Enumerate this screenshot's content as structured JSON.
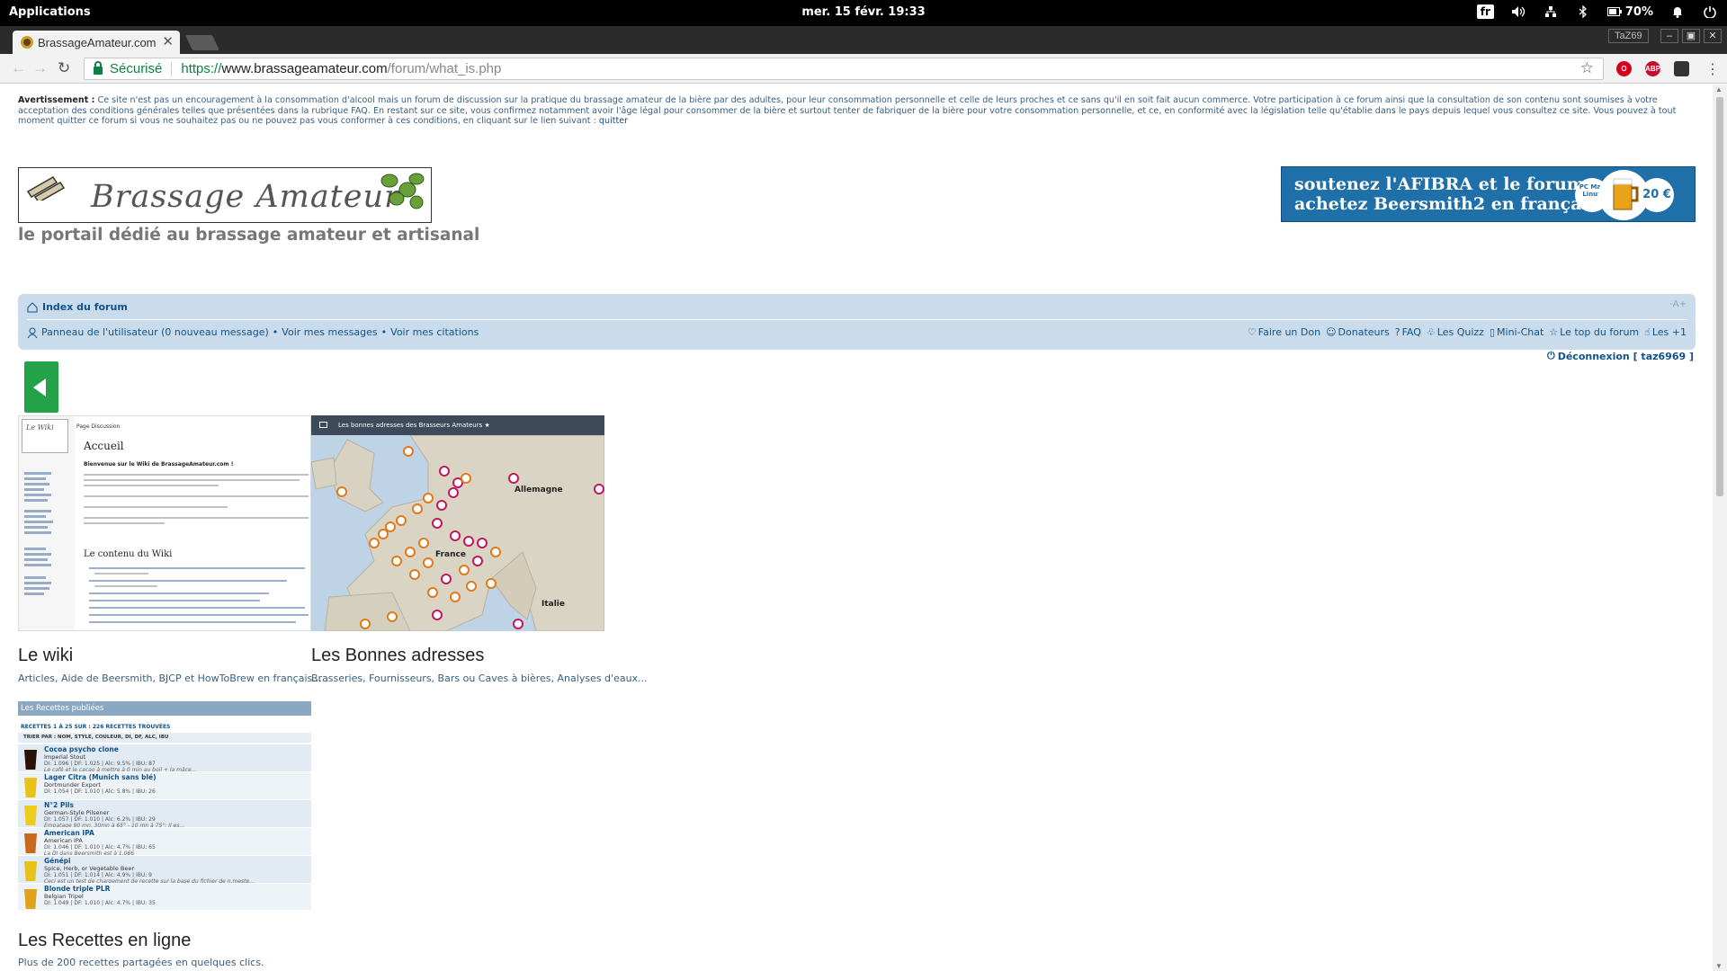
{
  "os": {
    "apps_label": "Applications",
    "clock": "mer. 15 févr.   19:33",
    "keyboard": "fr",
    "battery": "70%"
  },
  "browser": {
    "tab_title": "BrassageAmateur.com",
    "profile": "TaZ69",
    "secure_label": "Sécurisé",
    "url_scheme": "https://",
    "url_host": "www.brassageamateur.com",
    "url_path": "/forum/what_is.php",
    "ext_abp": "ABP"
  },
  "warning": {
    "label": "Avertissement :",
    "text": " Ce site n'est pas un encouragement à la consommation d'alcool mais un forum de discussion sur la pratique du brassage amateur de la bière par des adultes, pour leur consommation personnelle et celle de leurs proches et ce sans qu'il en soit fait aucun commerce. Votre participation à ce forum ainsi que la consultation de son contenu sont soumises à votre acceptation des conditions générales telles que présentées dans la rubrique FAQ. En restant sur ce site, vous confirmez notamment avoir l'âge légal pour consommer de la bière et surtout tenter de fabriquer de la bière pour votre consommation personnelle, et ce, en conformité avec la législation telle qu'établie dans le pays depuis lequel vous consultez ce site. Vous pouvez à tout moment quitter ce forum si vous ne souhaitez pas ou ne pouvez pas vous conformer à ces conditions, en cliquant sur le lien suivant : ",
    "link": "quitter"
  },
  "header": {
    "logo_text": "Brassage Amateur",
    "tagline": "le portail dédié au brassage amateur et artisanal",
    "banner_line1": "soutenez l'AFIBRA et le forum",
    "banner_line2": "achetez Beersmith2 en français",
    "banner_badge": "PC Mac Linux",
    "banner_price": "20 €"
  },
  "nav": {
    "index": "Index du forum",
    "font_size": "-A+",
    "user_panel": "Panneau de l'utilisateur (0 nouveau message)",
    "my_messages": "Voir mes messages",
    "my_quotes": "Voir mes citations",
    "links": [
      "Faire un Don",
      "Donateurs",
      "FAQ",
      "Les Quizz",
      "Mini-Chat",
      "Le top du forum",
      "Les +1"
    ],
    "logout": "Déconnexion [ taz6969 ]"
  },
  "cards": {
    "wiki": {
      "title": "Le wiki",
      "desc": "Articles, Aide de Beersmith, BJCP et HowToBrew en français...",
      "h1": "Accueil",
      "h2": "Le contenu du Wiki",
      "bold": "Bienvenue sur le Wiki de BrassageAmateur.com !",
      "tabs": "Page   Discussion",
      "logo": "Le Wiki"
    },
    "map": {
      "title": "Les Bonnes adresses",
      "desc": "Brasseries, Fournisseurs, Bars ou Caves à bières, Analyses d'eaux...",
      "header": "Les bonnes adresses des Brasseurs Amateurs ★",
      "labels": [
        "Allemagne",
        "France",
        "Italie"
      ]
    },
    "recipes": {
      "title": "Les Recettes en ligne",
      "desc": "Plus de 200 recettes partagées en quelques clics.",
      "header": "Les Recettes publiées",
      "count": "RECETTES 1 À 25 SUR : 226 RECETTES TROUVÉES",
      "sort": "TRIER PAR : NOM, STYLE, COULEUR, DI, DF, ALC, IBU",
      "rows": [
        {
          "name": "Cocoa psycho clone",
          "style": "Imperial Stout",
          "stats": "DI: 1.096 | DF: 1.025 | Alc: 9.5% | IBU: 87",
          "note": "Le café et le cacao à mettre à 0 min au boil + la mâce...",
          "color": "#2a1208"
        },
        {
          "name": "Lager Citra (Munich sans blé)",
          "style": "Dortmunder Export",
          "stats": "DI: 1.054 | DF: 1.010 | Alc: 5.8% | IBU: 26",
          "note": "",
          "color": "#e8c21a"
        },
        {
          "name": "N°2 Pils",
          "style": "German-Style Pilsener",
          "stats": "DI: 1.057 | DF: 1.010 | Alc: 6.2% | IBU: 29",
          "note": "Empatage 90 mn. 30mn à 65° - 10 mn à 75°; Il es...",
          "color": "#eccc1c"
        },
        {
          "name": "American IPA",
          "style": "American IPA",
          "stats": "DI: 1.046 | DF: 1.010 | Alc: 4.7% | IBU: 65",
          "note": "La DI dans Beersmith est à 1.066",
          "color": "#c86a1e"
        },
        {
          "name": "Génépi",
          "style": "Spice, Herb, or Vegetable Beer",
          "stats": "DI: 1.051 | DF: 1.014 | Alc: 4.9% | IBU: 9",
          "note": "Ceci est un test de chargement de recette sur la base du fichier de n.meste...",
          "color": "#e8c21a"
        },
        {
          "name": "Blonde triple PLR",
          "style": "Belgian Tripel",
          "stats": "DI: 1.049 | DF: 1.010 | Alc: 4.7% | IBU: 35",
          "note": "",
          "color": "#dfa21a"
        }
      ]
    }
  }
}
